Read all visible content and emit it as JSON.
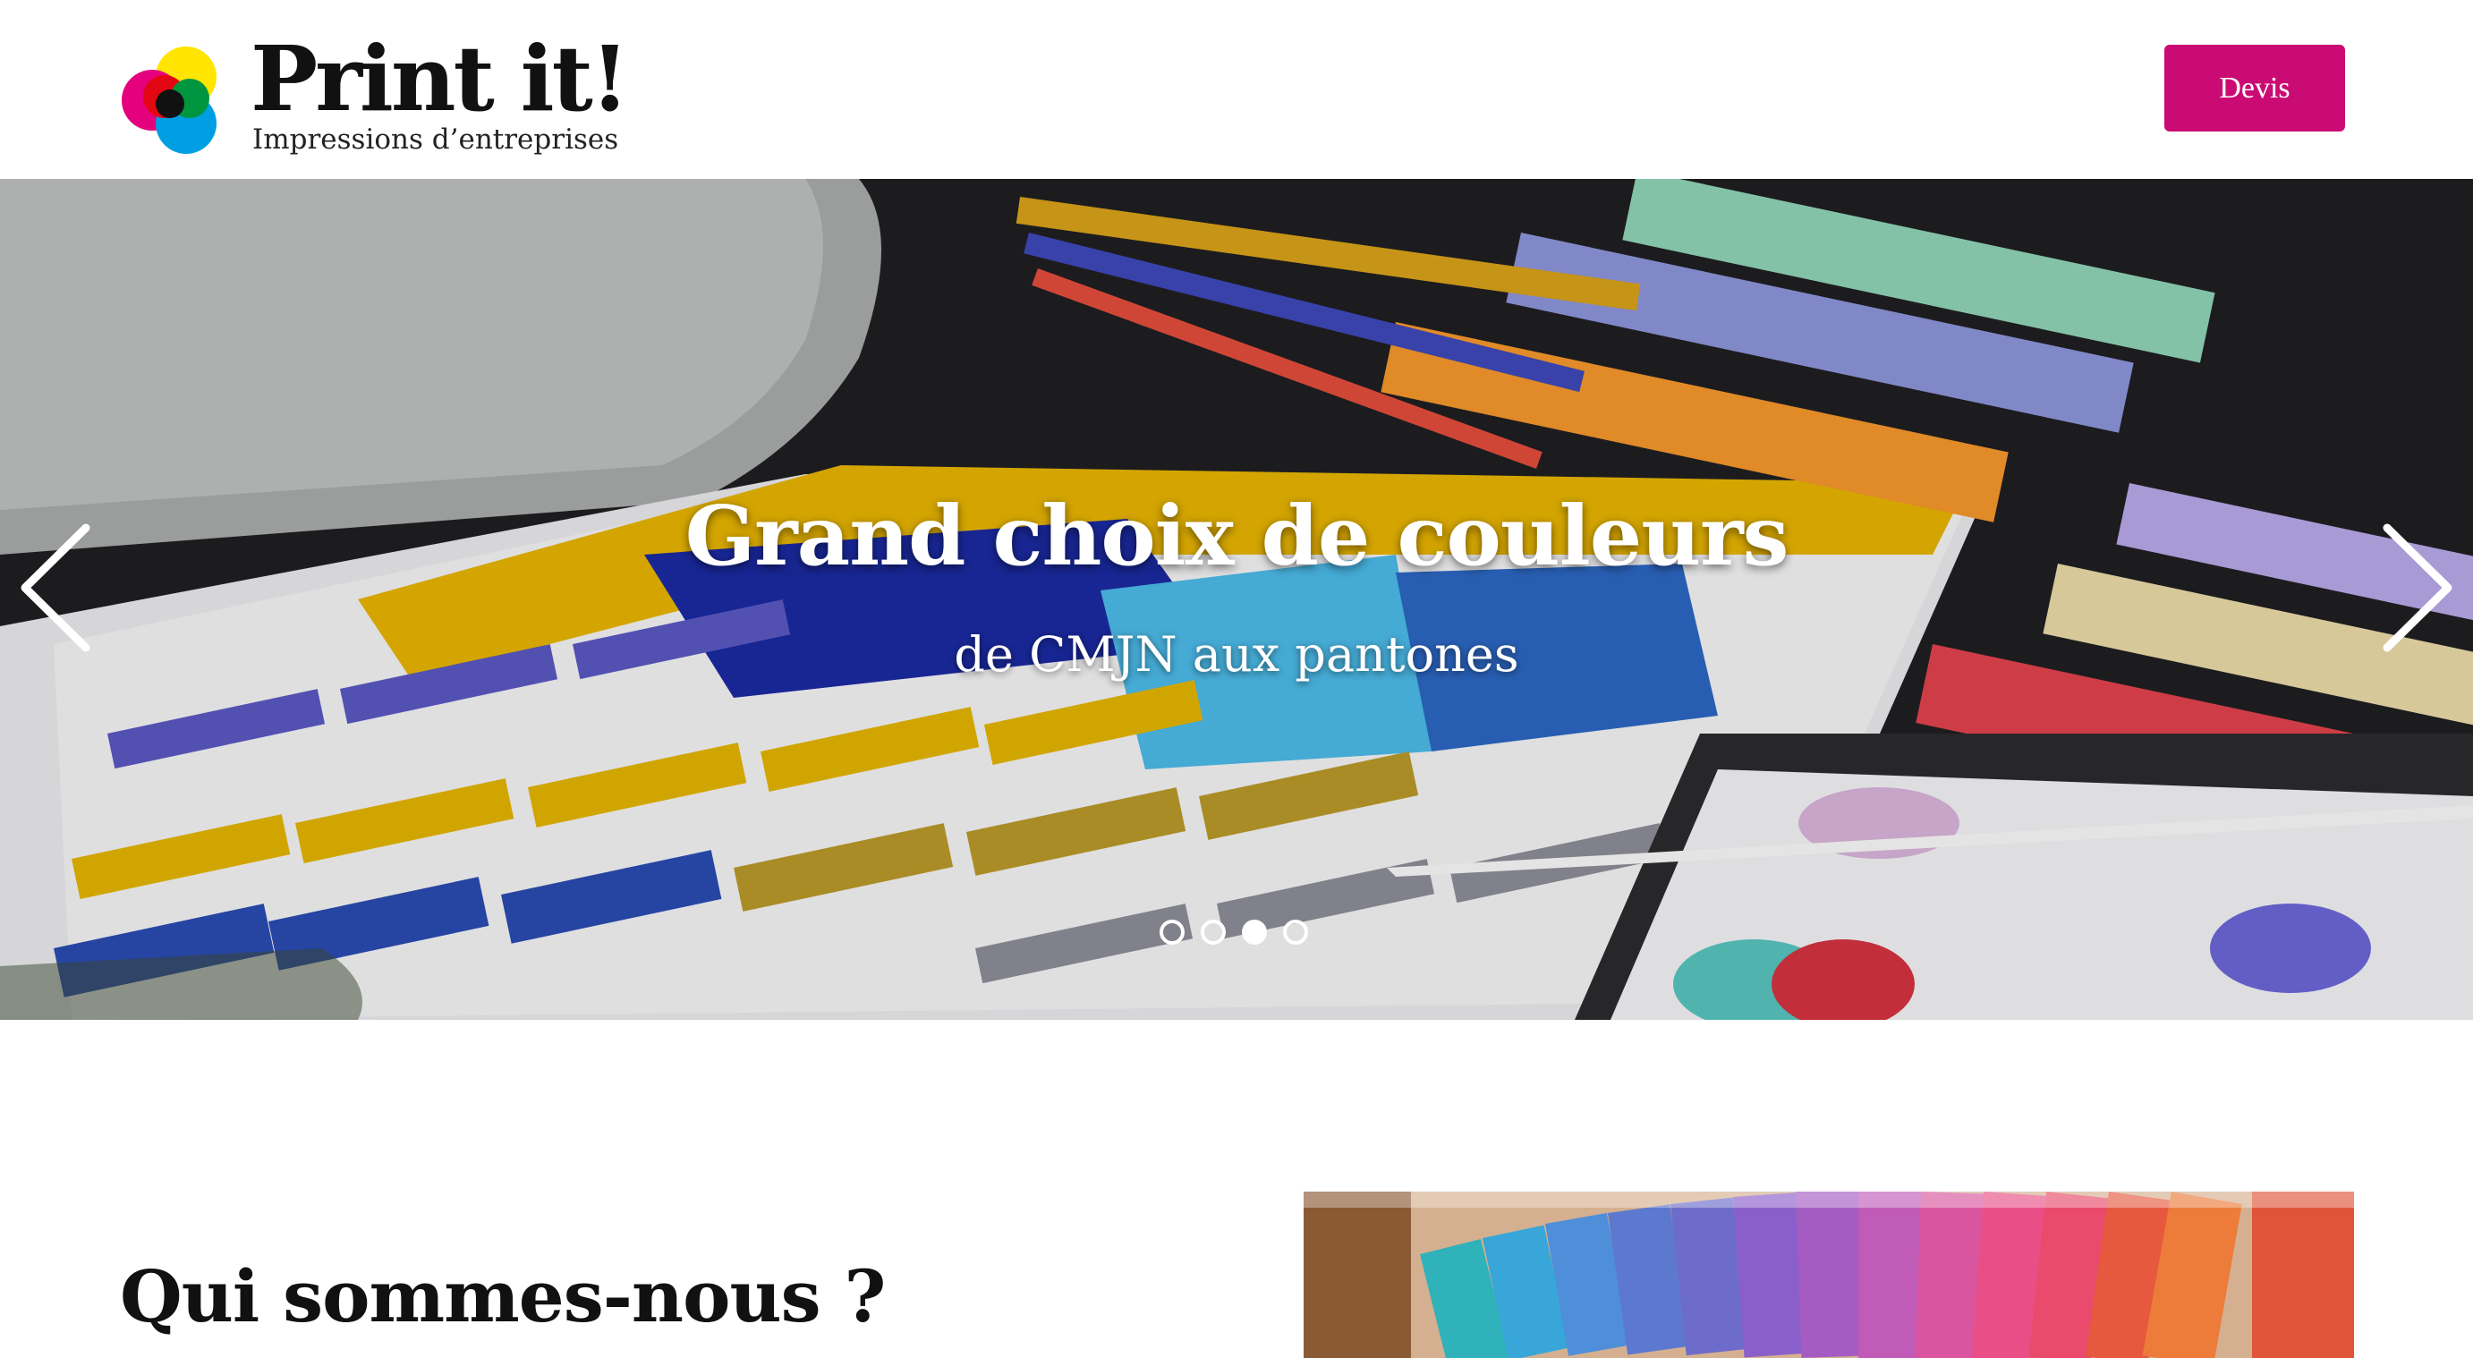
{
  "header": {
    "logo_title": "Print it!",
    "logo_subtitle": "Impressions d’entreprises",
    "cta_label": "Devis"
  },
  "hero": {
    "title": "Grand choix de couleurs",
    "subtitle": "de CMJN aux pantones",
    "prev_icon": "chevron-left-icon",
    "next_icon": "chevron-right-icon",
    "slide_count": 4,
    "active_slide": 3
  },
  "about": {
    "title": "Qui sommes-nous ?"
  },
  "colors": {
    "accent": "#cb0b74",
    "header_bg": "#ffffff",
    "text": "#111111"
  }
}
